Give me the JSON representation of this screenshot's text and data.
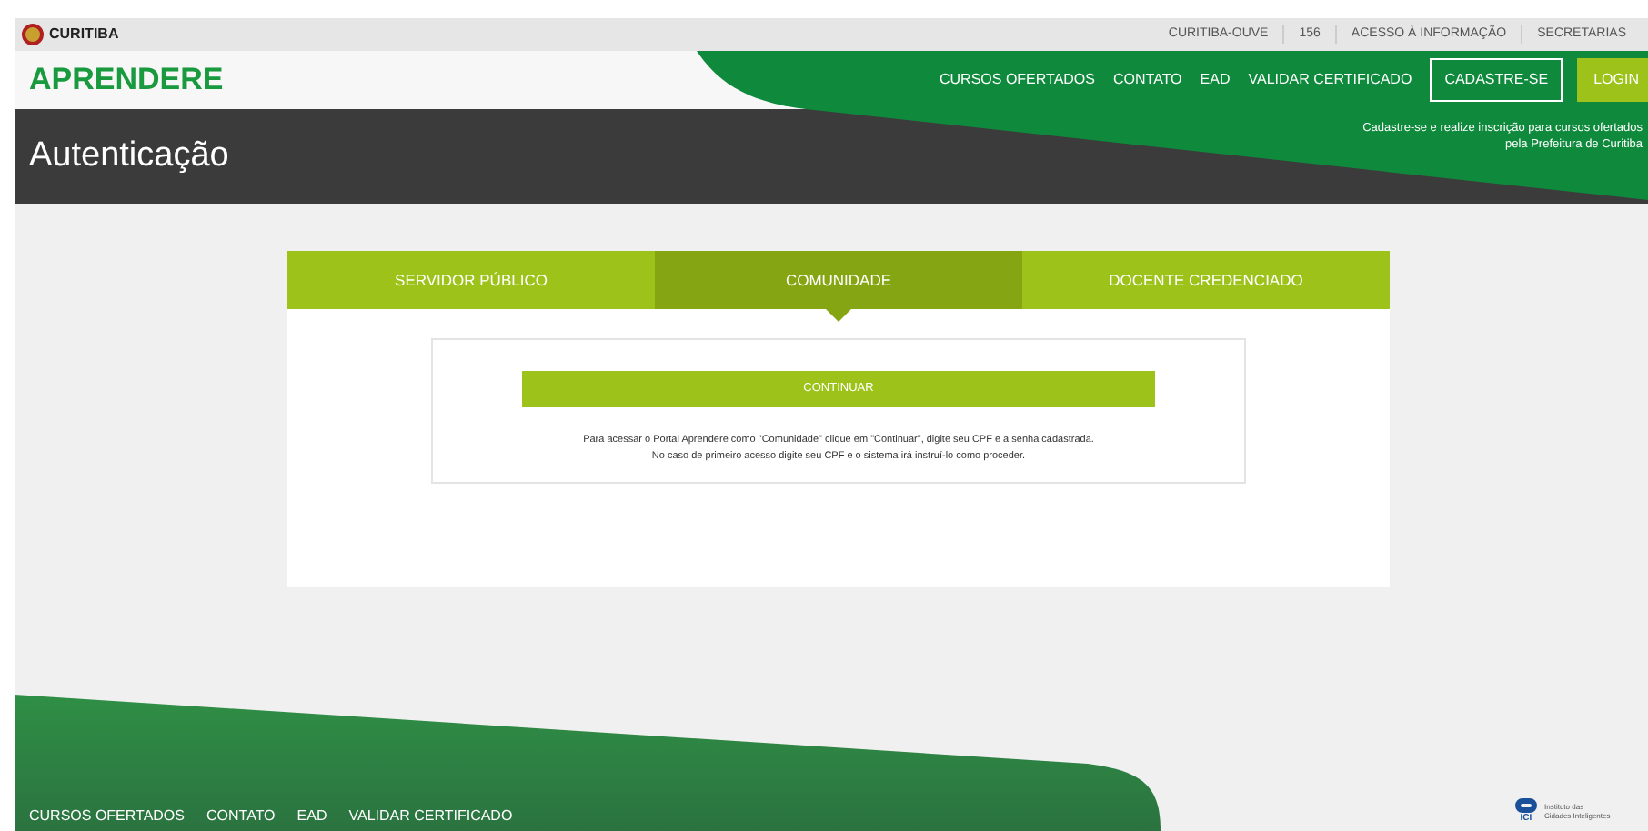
{
  "top_bar": {
    "brand": "CURITIBA",
    "links": [
      "CURITIBA-OUVE",
      "156",
      "ACESSO À INFORMAÇÃO",
      "SECRETARIAS"
    ]
  },
  "nav": {
    "logo": "APRENDERE",
    "links": [
      "CURSOS OFERTADOS",
      "CONTATO",
      "EAD",
      "VALIDAR CERTIFICADO"
    ],
    "register_button": "CADASTRE-SE",
    "login_button": "LOGIN"
  },
  "title_bar": {
    "title": "Autenticação",
    "note_lines": [
      "Cadastre-se e realize inscrição para cursos ofertados",
      "pela Prefeitura de Curitiba"
    ]
  },
  "tabs": [
    {
      "label": "SERVIDOR PÚBLICO",
      "selected": false
    },
    {
      "label": "COMUNIDADE",
      "selected": true
    },
    {
      "label": "DOCENTE CREDENCIADO",
      "selected": false
    }
  ],
  "panel": {
    "button": "CONTINUAR",
    "help_lines": [
      "Para acessar o Portal Aprendere como \"Comunidade\" clique em \"Continuar\", digite seu CPF e a senha cadastrada.",
      "No caso de primeiro acesso digite seu CPF e o sistema irá instruí-lo como proceder."
    ]
  },
  "footer": {
    "links": [
      "CURSOS OFERTADOS",
      "CONTATO",
      "EAD",
      "VALIDAR CERTIFICADO"
    ],
    "logo_mark": "ICI",
    "logo_text_lines": [
      "Instituto das",
      "Cidades Inteligentes"
    ]
  }
}
